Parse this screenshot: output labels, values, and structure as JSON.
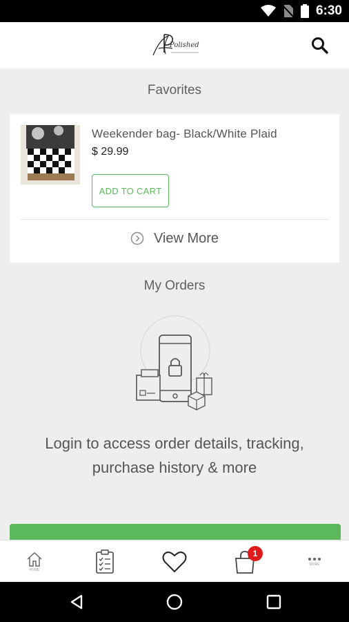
{
  "status_bar": {
    "time": "6:30"
  },
  "header": {
    "logo_text": "Polished",
    "search_icon": "search-icon"
  },
  "favorites": {
    "title": "Favorites",
    "items": [
      {
        "name": "Weekender bag- Black/White Plaid",
        "price": "$ 29.99",
        "add_to_cart_label": "ADD TO CART"
      }
    ],
    "view_more_label": "View More"
  },
  "orders": {
    "title": "My Orders",
    "message": "Login to access order details, tracking, purchase history & more"
  },
  "colors": {
    "accent_green": "#5cb85c",
    "badge_red": "#e01a1a",
    "background": "#eeeeee"
  },
  "bottom_nav": {
    "items": [
      {
        "icon": "home-icon",
        "label": "HOME"
      },
      {
        "icon": "orders-clipboard-icon"
      },
      {
        "icon": "heart-icon"
      },
      {
        "icon": "shopping-bag-icon",
        "badge": "1"
      },
      {
        "icon": "more-dots-icon",
        "label": "MORE"
      }
    ]
  },
  "system_nav": {
    "icons": [
      "back-icon",
      "home-circle-icon",
      "recents-icon"
    ]
  }
}
